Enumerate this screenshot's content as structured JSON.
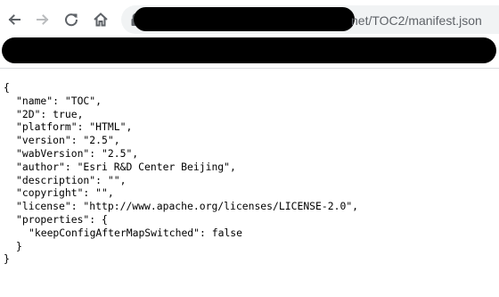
{
  "browser": {
    "url_visible_suffix": "net/TOC2/manifest.json",
    "back_icon": "arrow-left-icon",
    "forward_icon": "arrow-right-icon",
    "reload_icon": "reload-icon",
    "home_icon": "home-icon",
    "lock_icon": "lock-icon"
  },
  "colors": {
    "toolbar_icon": "#5f6368",
    "forward_icon_disabled": "#babcbe",
    "omnibox_bg": "#f1f3f4",
    "redaction": "#000000"
  },
  "json_lines": [
    "{",
    "\"name\": \"TOC\",",
    "\"2D\": true,",
    "\"platform\": \"HTML\",",
    "\"version\": \"2.5\",",
    "\"wabVersion\": \"2.5\",",
    "\"author\": \"Esri R&D Center Beijing\",",
    "\"description\": \"\",",
    "\"copyright\": \"\",",
    "\"license\": \"http://www.apache.org/licenses/LICENSE-2.0\",",
    "\"properties\": {",
    "\"keepConfigAfterMapSwitched\": false",
    "}",
    "}"
  ]
}
